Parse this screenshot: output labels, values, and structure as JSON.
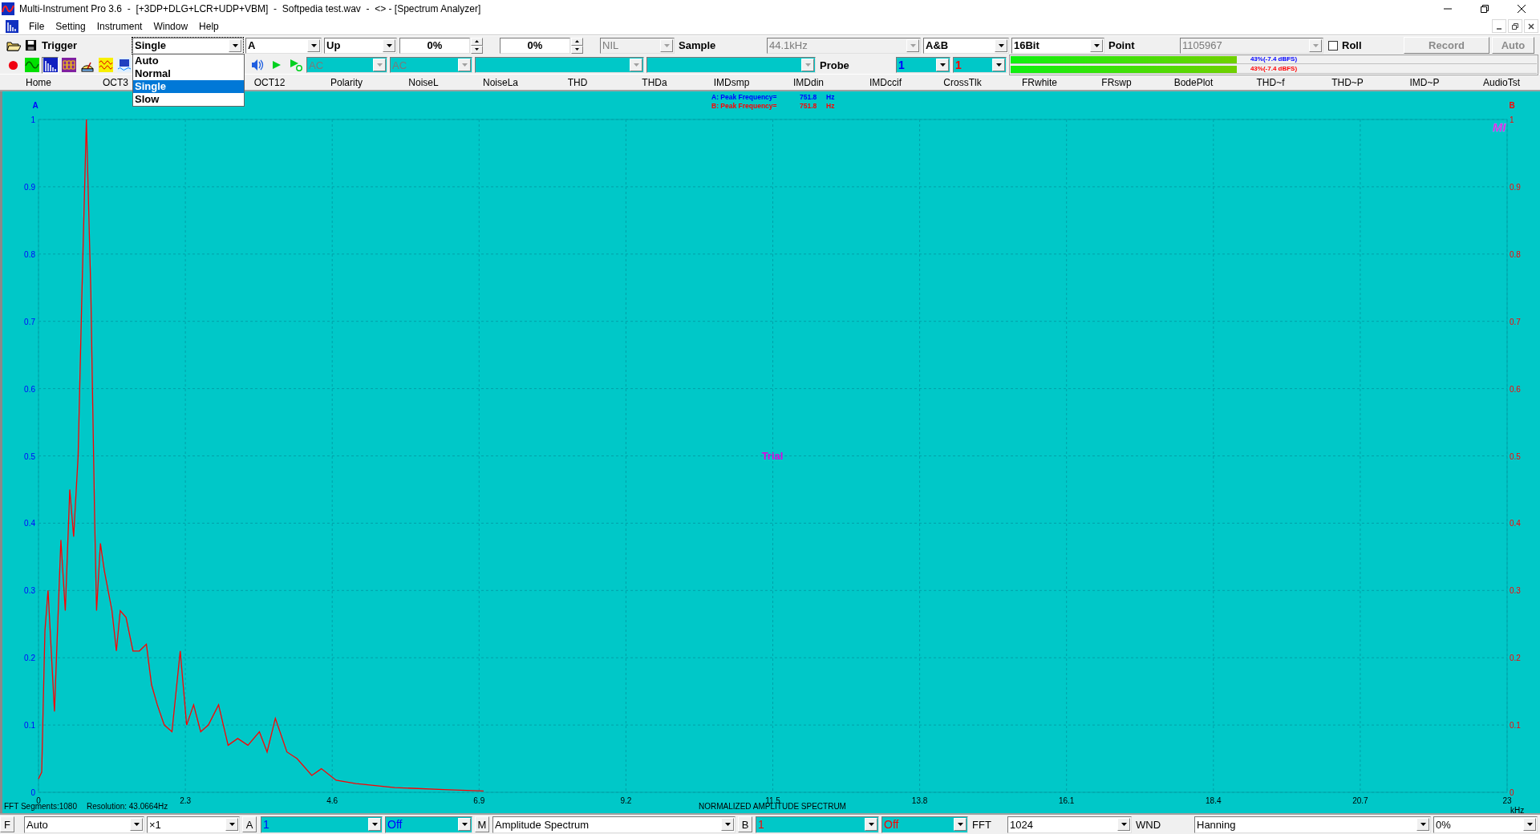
{
  "window": {
    "title": "Multi-Instrument Pro 3.6  -  [+3DP+DLG+LCR+UDP+VBM]  -  Softpedia test.wav  -  <> - [Spectrum Analyzer]"
  },
  "menu": [
    "File",
    "Setting",
    "Instrument",
    "Window",
    "Help"
  ],
  "toolbar": {
    "items": [
      {
        "kind": "label",
        "text": "Trigger"
      },
      {
        "kind": "combo",
        "value": "Single",
        "disabled": false,
        "open": true
      },
      {
        "kind": "combo",
        "value": "A",
        "disabled": false,
        "open": false
      },
      {
        "kind": "combo",
        "value": "Up",
        "disabled": false,
        "open": false
      },
      {
        "kind": "spin",
        "value": "0%"
      },
      {
        "kind": "spin",
        "value": "0%"
      },
      {
        "kind": "combo",
        "value": "NIL",
        "disabled": true,
        "open": false
      },
      {
        "kind": "label",
        "text": "Sample"
      },
      {
        "kind": "combo",
        "value": "44.1kHz",
        "disabled": true,
        "open": false
      },
      {
        "kind": "combo",
        "value": "A&B",
        "disabled": false,
        "open": false
      },
      {
        "kind": "combo",
        "value": "16Bit",
        "disabled": false,
        "open": false
      },
      {
        "kind": "label",
        "text": "Point"
      },
      {
        "kind": "combo",
        "value": "1105967",
        "disabled": true,
        "open": false
      },
      {
        "kind": "check",
        "text": "Roll",
        "checked": false
      },
      {
        "kind": "button",
        "text": "Record",
        "disabled": true
      },
      {
        "kind": "button",
        "text": "Auto",
        "disabled": true
      }
    ],
    "trigger_options": [
      {
        "label": "Auto",
        "selected": false
      },
      {
        "label": "Normal",
        "selected": false
      },
      {
        "label": "Single",
        "selected": true
      },
      {
        "label": "Slow",
        "selected": false
      }
    ]
  },
  "mode_toolbar": {
    "modes": [
      {
        "selected": false
      },
      {
        "selected": true
      },
      {
        "selected": false
      },
      {
        "selected": false
      },
      {
        "selected": false
      },
      {
        "selected": false
      }
    ],
    "items": [
      {
        "kind": "cyan-combo",
        "value": "AC",
        "disabled": true
      },
      {
        "kind": "cyan-combo",
        "value": "AC",
        "disabled": true
      },
      {
        "kind": "cyan-combo",
        "disabled": true
      },
      {
        "kind": "cyan-combo",
        "disabled": true
      },
      {
        "kind": "label",
        "text": "Probe"
      },
      {
        "kind": "channel-a-combo",
        "value": "1",
        "disabled": false
      },
      {
        "kind": "channel-b-combo",
        "value": "1",
        "disabled": false
      }
    ],
    "meters": [
      {
        "level": 0.43,
        "reading": "43%(-7.4 dBFS)",
        "color": "#0000ff"
      },
      {
        "level": 0.43,
        "reading": "43%(-7.4 dBFS)",
        "color": "#ff0000"
      }
    ]
  },
  "tabs": [
    {
      "label": "Home",
      "selected": false
    },
    {
      "label": "OCT3",
      "selected": false
    },
    {
      "label": "OCT12",
      "selected": false
    },
    {
      "label": "Polarity",
      "selected": false
    },
    {
      "label": "NoiseL",
      "selected": false
    },
    {
      "label": "NoiseLa",
      "selected": false
    },
    {
      "label": "THD",
      "selected": false
    },
    {
      "label": "THDa",
      "selected": false
    },
    {
      "label": "IMDsmp",
      "selected": false
    },
    {
      "label": "IMDdin",
      "selected": false
    },
    {
      "label": "IMDccif",
      "selected": false
    },
    {
      "label": "CrossTlk",
      "selected": false
    },
    {
      "label": "FRwhite",
      "selected": false
    },
    {
      "label": "FRswp",
      "selected": false
    },
    {
      "label": "BodePlot",
      "selected": false
    },
    {
      "label": "THD~f",
      "selected": false
    },
    {
      "label": "THD~P",
      "selected": false
    },
    {
      "label": "IMD~P",
      "selected": false
    },
    {
      "label": "AudioTst",
      "selected": false
    }
  ],
  "plot": {
    "left_axis": "A",
    "right_axis": "B",
    "peaks": [
      {
        "label": "A: Peak Frequency=",
        "value": "751.8",
        "unit": "Hz",
        "color": "#0000ff"
      },
      {
        "label": "B: Peak Frequency=",
        "value": "751.8",
        "unit": "Hz",
        "color": "#ff0000"
      }
    ],
    "trial_text": "Trial",
    "logo": "MI",
    "segments": "FFT Segments:1080",
    "resolution": "Resolution: 43.0664Hz",
    "chart_data": {
      "type": "line",
      "title": "NORMALIZED AMPLITUDE SPECTRUM",
      "xlabel": "kHz",
      "xlim": [
        0,
        23
      ],
      "ylim": [
        0,
        1
      ],
      "xticks": [
        0,
        2.3,
        4.6,
        6.9,
        9.2,
        11.5,
        13.8,
        16.1,
        18.4,
        20.7,
        23
      ],
      "grid": true,
      "yticks": [
        {
          "value": 0,
          "label": "0"
        },
        {
          "value": 0.1,
          "label": "0.1"
        },
        {
          "value": 0.2,
          "label": "0.2"
        },
        {
          "value": 0.3,
          "label": "0.3"
        },
        {
          "value": 0.4,
          "label": "0.4"
        },
        {
          "value": 0.5,
          "label": "0.5"
        },
        {
          "value": 0.6,
          "label": "0.6"
        },
        {
          "value": 0.7,
          "label": "0.7"
        },
        {
          "value": 0.8,
          "label": "0.8"
        },
        {
          "value": 0.9,
          "label": "0.9"
        },
        {
          "value": 1,
          "label": "1"
        }
      ],
      "x": [
        0,
        0.05,
        0.1,
        0.15,
        0.25,
        0.35,
        0.42,
        0.49,
        0.55,
        0.62,
        0.68,
        0.75,
        0.82,
        0.88,
        0.91,
        0.97,
        1.03,
        1.09,
        1.15,
        1.22,
        1.28,
        1.37,
        1.48,
        1.58,
        1.69,
        1.77,
        1.86,
        1.97,
        2.09,
        2.22,
        2.32,
        2.43,
        2.54,
        2.66,
        2.82,
        2.97,
        3.12,
        3.28,
        3.46,
        3.58,
        3.71,
        3.89,
        4.05,
        4.28,
        4.43,
        4.66,
        4.97,
        5.58,
        6.35,
        6.97
      ],
      "series": [
        {
          "color": "#ff0000",
          "values": [
            0.02,
            0.03,
            0.24,
            0.3,
            0.12,
            0.375,
            0.27,
            0.45,
            0.38,
            0.5,
            0.74,
            1,
            0.74,
            0.4,
            0.27,
            0.37,
            0.33,
            0.3,
            0.27,
            0.21,
            0.27,
            0.26,
            0.21,
            0.21,
            0.22,
            0.16,
            0.13,
            0.1,
            0.09,
            0.21,
            0.1,
            0.13,
            0.09,
            0.1,
            0.13,
            0.07,
            0.08,
            0.07,
            0.09,
            0.06,
            0.11,
            0.06,
            0.05,
            0.025,
            0.035,
            0.018,
            0.013,
            0.007,
            0.004,
            0.002
          ]
        }
      ]
    },
    "right_ticks": [
      "1",
      "0.9",
      "0.8",
      "0.7",
      "0.6",
      "0.5",
      "0.4",
      "0.3",
      "0.2",
      "0.1",
      "0"
    ]
  },
  "bottom_bar": {
    "items": [
      {
        "kind": "boxlabel",
        "text": "F"
      },
      {
        "kind": "combo",
        "value": "Auto",
        "disabled": false
      },
      {
        "kind": "combo",
        "value": "×1",
        "disabled": false
      },
      {
        "kind": "boxlabel",
        "text": "A"
      },
      {
        "kind": "channel-a-combo",
        "value": "1",
        "disabled": false
      },
      {
        "kind": "channel-a-combo",
        "value": "Off",
        "disabled": false
      },
      {
        "kind": "boxlabel",
        "text": "M"
      },
      {
        "kind": "combo",
        "value": "Amplitude Spectrum",
        "disabled": false
      },
      {
        "kind": "boxlabel",
        "text": "B"
      },
      {
        "kind": "channel-b-combo",
        "value": "1",
        "disabled": false
      },
      {
        "kind": "channel-b-combo",
        "value": "Off",
        "disabled": false
      },
      {
        "kind": "label",
        "text": "FFT"
      },
      {
        "kind": "combo",
        "value": "1024",
        "disabled": false
      },
      {
        "kind": "label",
        "text": "WND"
      },
      {
        "kind": "combo",
        "value": "Hanning",
        "disabled": false
      },
      {
        "kind": "combo",
        "value": "0%",
        "disabled": false
      }
    ]
  }
}
